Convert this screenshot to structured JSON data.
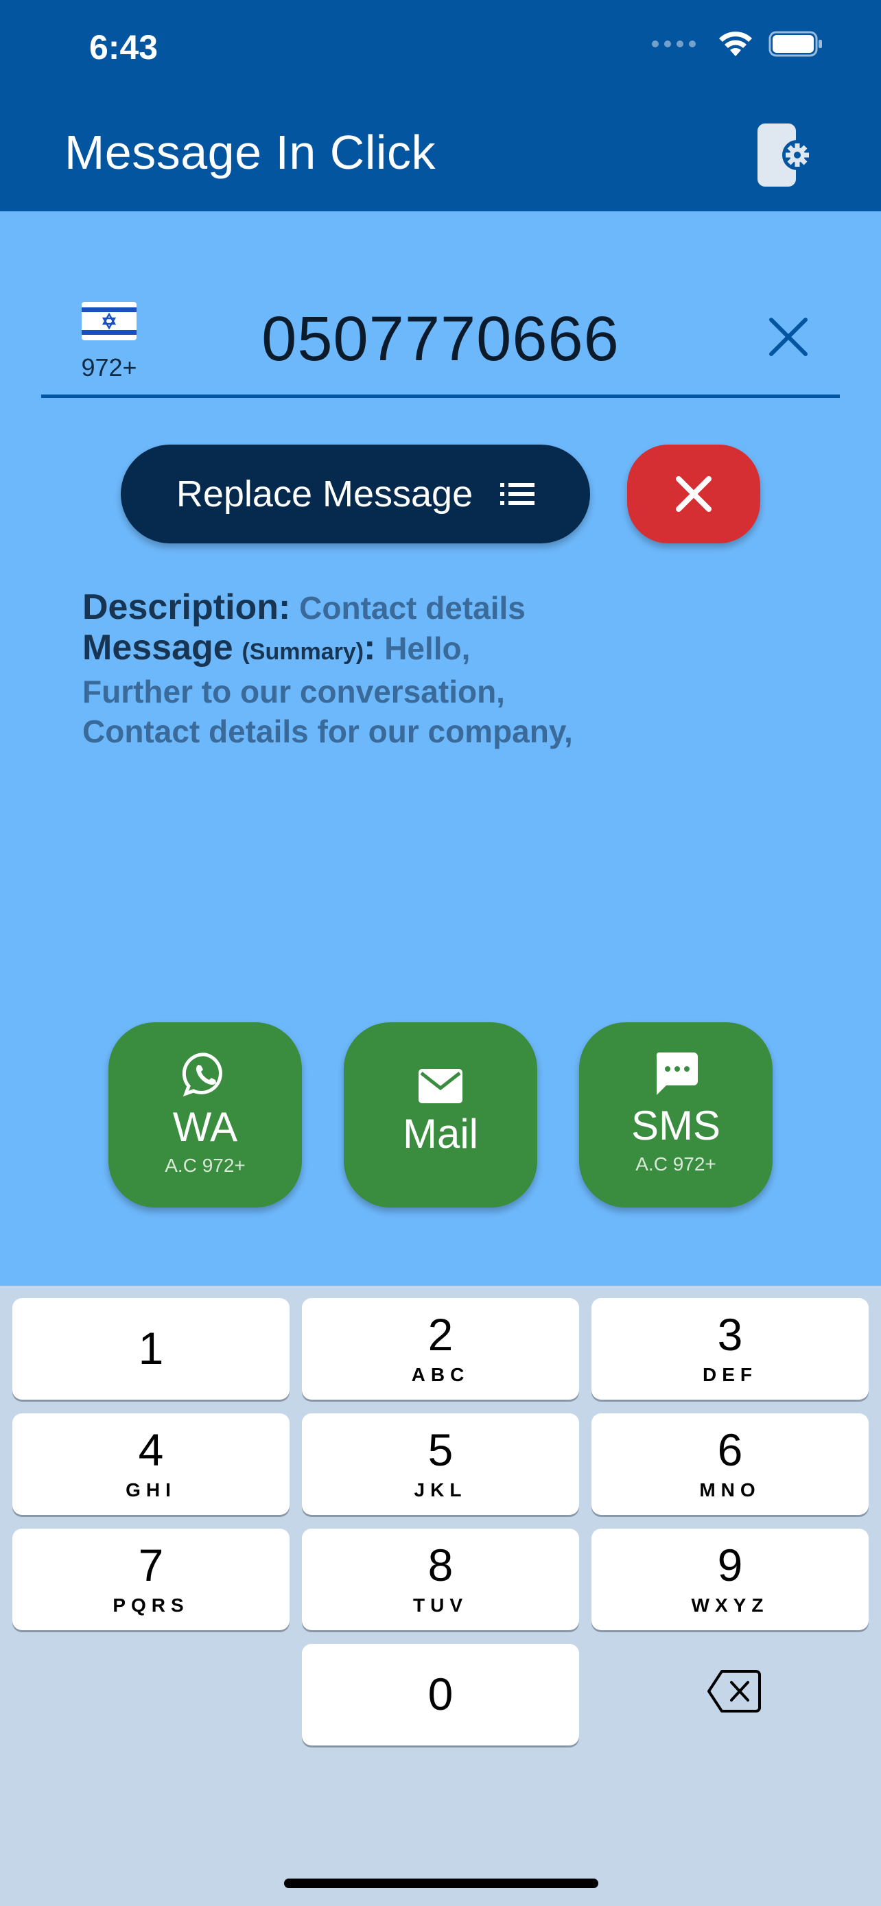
{
  "status_bar": {
    "time": "6:43"
  },
  "app": {
    "title": "Message In Click"
  },
  "phone": {
    "country_code": "972+",
    "number": "0507770666"
  },
  "replace": {
    "label": "Replace Message"
  },
  "details": {
    "description_label": "Description:",
    "description_value": "Contact details",
    "message_label": "Message",
    "message_sub": "(Summary)",
    "message_colon": ":",
    "message_line1": "Hello,",
    "message_line2": "Further to our conversation,",
    "message_line3": "Contact details for our company,"
  },
  "actions": [
    {
      "label": "WA",
      "sub": "A.C 972+",
      "icon": "whatsapp-icon"
    },
    {
      "label": "Mail",
      "sub": "",
      "icon": "mail-icon"
    },
    {
      "label": "SMS",
      "sub": "A.C 972+",
      "icon": "sms-icon"
    }
  ],
  "keypad": {
    "keys": [
      {
        "num": "1",
        "letters": ""
      },
      {
        "num": "2",
        "letters": "ABC"
      },
      {
        "num": "3",
        "letters": "DEF"
      },
      {
        "num": "4",
        "letters": "GHI"
      },
      {
        "num": "5",
        "letters": "JKL"
      },
      {
        "num": "6",
        "letters": "MNO"
      },
      {
        "num": "7",
        "letters": "PQRS"
      },
      {
        "num": "8",
        "letters": "TUV"
      },
      {
        "num": "9",
        "letters": "WXYZ"
      },
      {
        "num": "0",
        "letters": ""
      }
    ]
  },
  "colors": {
    "header": "#0355a0",
    "background": "#6db8fb",
    "replace_button": "#062a4d",
    "cancel_button": "#d62f33",
    "action_button": "#3a8c3e",
    "keypad_background": "#c4d6e8"
  }
}
